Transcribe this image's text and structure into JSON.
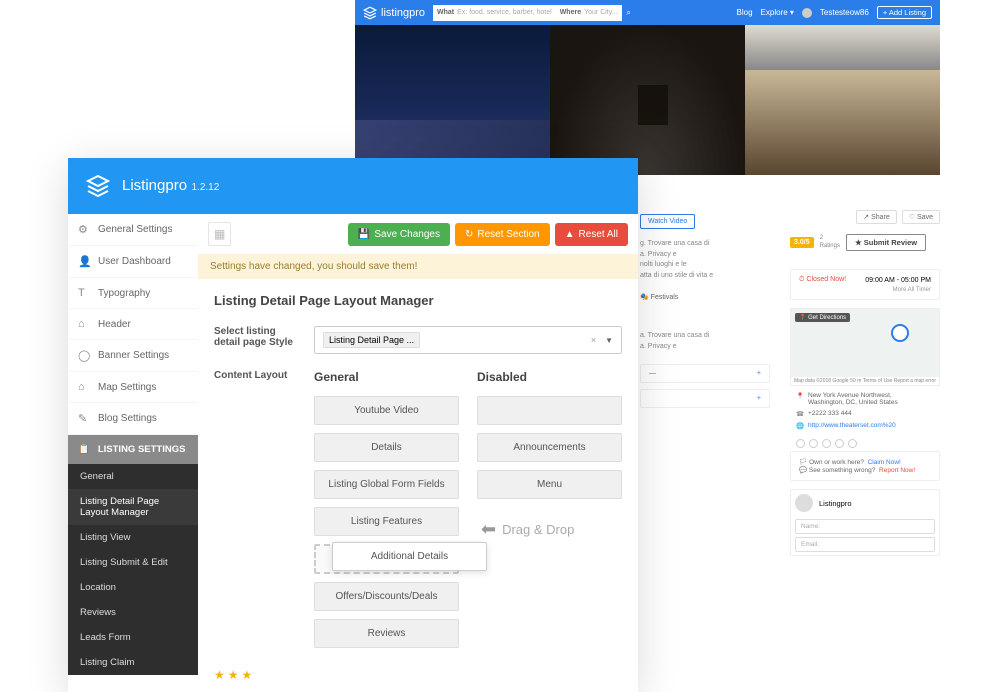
{
  "preview": {
    "brand": "listingpro",
    "search": {
      "what_label": "What",
      "what_ph": "Ex: food, service, barber, hotel",
      "where_label": "Where",
      "where_ph": "Your City..."
    },
    "nav": {
      "blog": "Blog",
      "explore": "Explore",
      "user": "Testesteow86",
      "add": "+ Add Listing"
    },
    "share": "Share",
    "save": "Save",
    "rating": "3.0",
    "rating_max": "5",
    "rating_count": "2",
    "rating_label": "Ratings",
    "submit": "Submit Review",
    "watch_video": "Watch Video",
    "closed": "Closed Now!",
    "hours": "09:00 AM - 05:00 PM",
    "more_hours": "More All Timer",
    "get_dir": "Get Directions",
    "map_foot_left": "Map data ©2018 Google",
    "map_foot_mid": "50 m",
    "map_foot_right": "Terms of Use   Report a map error",
    "address_l1": "New York Avenue Northwest,",
    "address_l2": "Washington, DC, United States",
    "phone": "+2222 333 444",
    "url": "http://www.theaterset.com%20",
    "claim_q": "Own or work here?",
    "claim_a": "Claim Now!",
    "wrong_q": "See something wrong?",
    "wrong_a": "Report Now!",
    "profile_name": "Listingpro",
    "input_name": "Name:",
    "input_email": "Email:",
    "desc1": "g. Trovare una casa di",
    "desc2": "a. Privacy e",
    "desc3": "nolti luoghi e le",
    "desc4": "atta di uno stile di vita e",
    "cat": "Festivals",
    "desc5": "a. Trovare una casa di",
    "desc6": "a. Privacy e"
  },
  "admin": {
    "brand": "Listingpro",
    "version": "1.2.12",
    "sidebar_main": [
      {
        "icon": "⚙",
        "label": "General Settings"
      },
      {
        "icon": "👤",
        "label": "User Dashboard"
      },
      {
        "icon": "T",
        "label": "Typography"
      },
      {
        "icon": "⌂",
        "label": "Header"
      },
      {
        "icon": "◯",
        "label": "Banner Settings"
      },
      {
        "icon": "⌂",
        "label": "Map Settings"
      },
      {
        "icon": "✎",
        "label": "Blog Settings"
      }
    ],
    "sidebar_sec": "LISTING SETTINGS",
    "sidebar_sub": [
      "General",
      "Listing Detail Page Layout Manager",
      "Listing View",
      "Listing Submit & Edit",
      "Location",
      "Reviews",
      "Leads Form",
      "Listing Claim"
    ],
    "active_sub": 1,
    "toolbar": {
      "save": "Save Changes",
      "reset": "Reset Section",
      "resetall": "Reset All"
    },
    "notice": "Settings have changed, you should save them!",
    "section_title": "Listing Detail Page Layout Manager",
    "style_label": "Select listing detail page Style",
    "style_value": "Listing Detail Page ...",
    "content_label": "Content Layout",
    "col_general": "General",
    "col_disabled": "Disabled",
    "general_items": [
      "Youtube Video",
      "Details",
      "Listing Global Form Fields",
      "Listing Features"
    ],
    "dragging": "Additional Details",
    "general_after": [
      "Offers/Discounts/Deals",
      "Reviews"
    ],
    "disabled_items": [
      "",
      "Announcements",
      "Menu"
    ],
    "drag_hint": "Drag & Drop"
  }
}
